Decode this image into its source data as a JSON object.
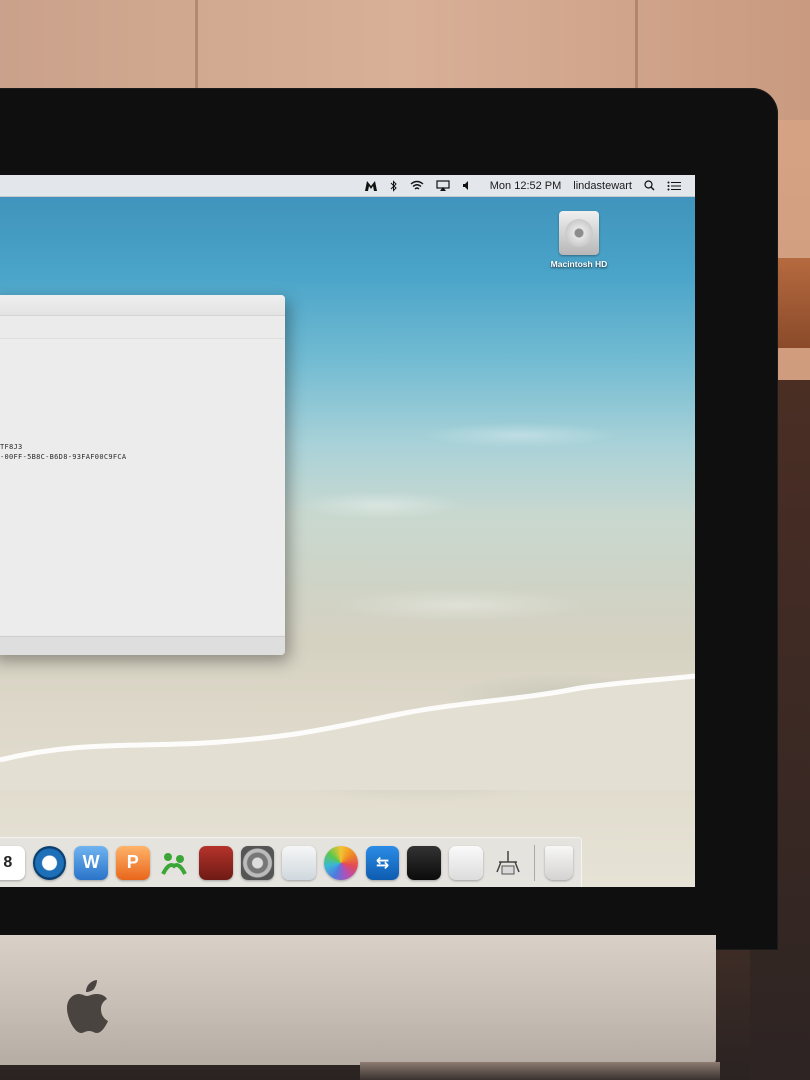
{
  "menubar": {
    "status_icons": [
      "malwarebytes-icon",
      "bluetooth-icon",
      "wifi-icon",
      "airplay-icon",
      "volume-icon"
    ],
    "clock": "Mon 12:52 PM",
    "username": "lindastewart",
    "right_icons": [
      "spotlight-icon",
      "notification-center-icon"
    ]
  },
  "desktop": {
    "hd_label": "Macintosh HD"
  },
  "window": {
    "line1": "TF8J3",
    "line2": "-00FF-5B8C-B6D8-93FAF00C9FCA"
  },
  "dock": {
    "apps": [
      "calendar-icon",
      "quicktime-icon",
      "word-icon",
      "powerpoint-icon",
      "messenger-icon",
      "photo-booth-icon",
      "system-preferences-icon",
      "preview-icon",
      "photos-icon",
      "teamviewer-icon",
      "dvd-player-icon",
      "textedit-icon",
      "directory-utility-icon"
    ],
    "trash": "trash-icon"
  },
  "colors": {
    "menubar": "#ececee",
    "dock": "#e6e6e8",
    "window": "#e9e9e9"
  }
}
